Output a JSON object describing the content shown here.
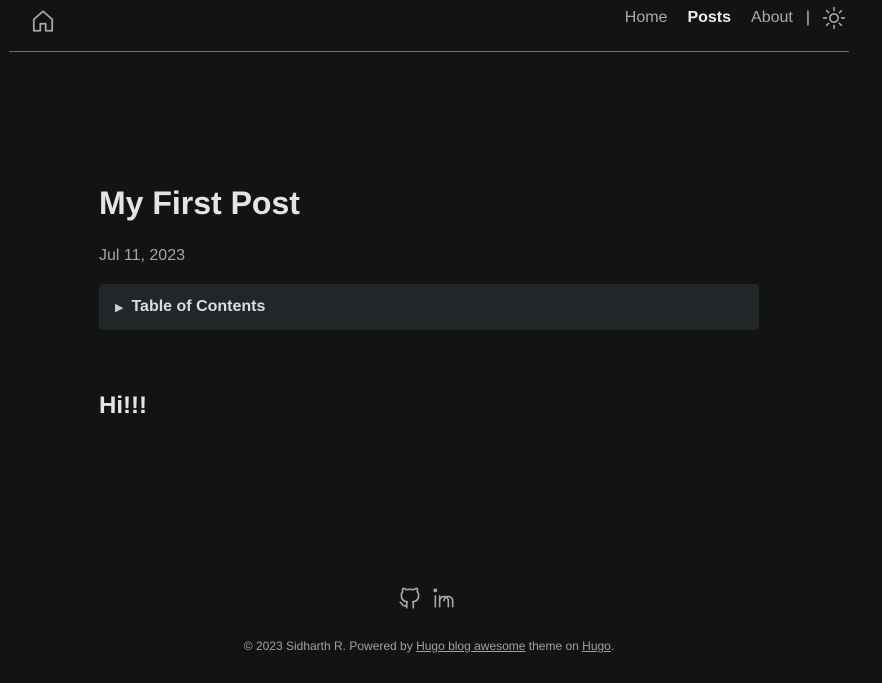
{
  "header": {
    "home_icon": "home-icon",
    "nav": {
      "home": "Home",
      "posts": "Posts",
      "about": "About",
      "separator": "|"
    },
    "theme_icon": "sun-icon"
  },
  "post": {
    "title": "My First Post",
    "date": "Jul 11, 2023",
    "toc_label": "Table of Contents",
    "toc_arrow": "▶",
    "heading": "Hi!!!"
  },
  "footer": {
    "social_icons": [
      "github-icon",
      "linkedin-icon"
    ],
    "copyright": "© 2023 Sidharth R. Powered by ",
    "theme_link": "Hugo blog awesome",
    "middle": " theme on ",
    "hugo_link": "Hugo",
    "end": "."
  },
  "colors": {
    "background": "#121414",
    "toc_background": "#222628",
    "divider": "#6e7064"
  }
}
